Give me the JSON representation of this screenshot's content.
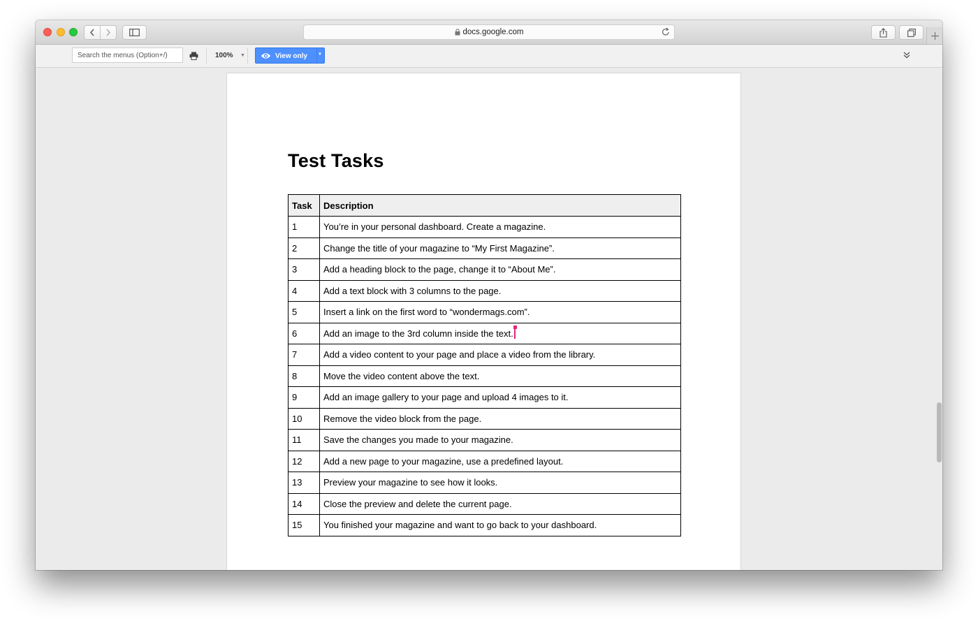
{
  "browser": {
    "url": "docs.google.com"
  },
  "toolbar": {
    "menu_search_placeholder": "Search the menus (Option+/)",
    "zoom": "100%",
    "view_mode": "View only"
  },
  "document": {
    "title": "Test Tasks",
    "table": {
      "headers": [
        "Task",
        "Description"
      ],
      "rows": [
        {
          "task": "1",
          "description": "You’re in your personal dashboard. Create a magazine."
        },
        {
          "task": "2",
          "description": "Change the title of your magazine to “My First Magazine”."
        },
        {
          "task": "3",
          "description": "Add a heading block to the page, change it to “About Me”."
        },
        {
          "task": "4",
          "description": "Add a text block with 3 columns to the page."
        },
        {
          "task": "5",
          "description": "Insert a link on the first word to “wondermags.com”."
        },
        {
          "task": "6",
          "description": "Add an image to the 3rd column inside the text."
        },
        {
          "task": "7",
          "description": "Add a video content to your page and place a video from the library."
        },
        {
          "task": "8",
          "description": "Move the video content above the text."
        },
        {
          "task": "9",
          "description": "Add an image gallery to your page and upload 4 images to it."
        },
        {
          "task": "10",
          "description": "Remove the video block from the page."
        },
        {
          "task": "11",
          "description": "Save the changes you made to your magazine."
        },
        {
          "task": "12",
          "description": "Add a new page to your magazine, use a predefined layout."
        },
        {
          "task": "13",
          "description": "Preview your magazine to see how it looks."
        },
        {
          "task": "14",
          "description": "Close the preview and delete the current page."
        },
        {
          "task": "15",
          "description": "You finished your magazine and want to go back to your dashboard."
        }
      ]
    }
  },
  "icons": {
    "back": "chevron-left-icon",
    "forward": "chevron-right-icon",
    "sidebar": "sidebar-icon",
    "lock": "lock-icon",
    "reload": "reload-icon",
    "share": "share-icon",
    "tabs": "tabs-icon",
    "new_tab": "plus-icon",
    "print": "print-icon",
    "eye": "eye-icon",
    "collapse": "double-chevron-icon"
  },
  "colors": {
    "accent": "#4d90fe",
    "cursor": "#e8217c"
  }
}
